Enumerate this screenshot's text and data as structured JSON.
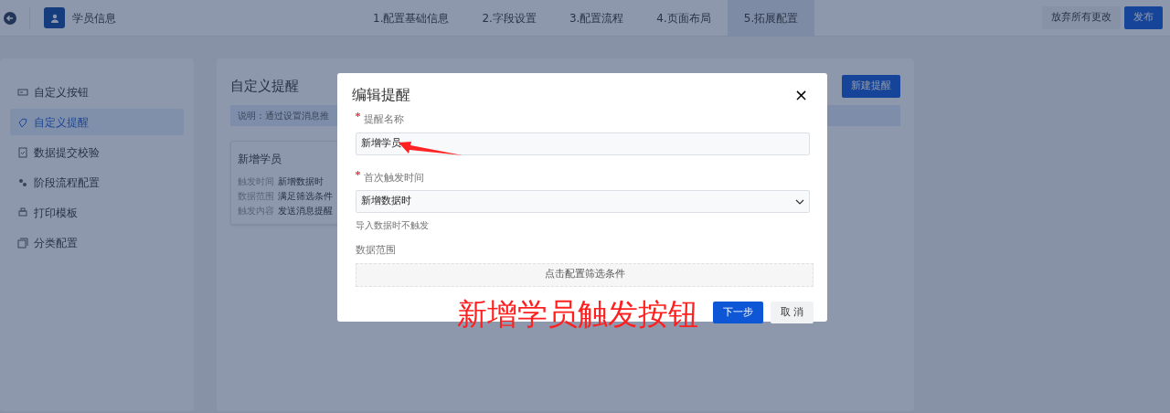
{
  "header": {
    "title": "学员信息",
    "steps": [
      {
        "label": "1.配置基础信息",
        "selected": false
      },
      {
        "label": "2.字段设置",
        "selected": false
      },
      {
        "label": "3.配置流程",
        "selected": false
      },
      {
        "label": "4.页面布局",
        "selected": false
      },
      {
        "label": "5.拓展配置",
        "selected": true
      }
    ],
    "buttons": [
      {
        "label": "放弃所有更改",
        "kind": "secondary"
      },
      {
        "label": "发布",
        "kind": "primary"
      }
    ]
  },
  "sidebar": {
    "items": [
      {
        "label": "自定义按钮",
        "selected": false
      },
      {
        "label": "自定义提醒",
        "selected": true
      },
      {
        "label": "数据提交校验",
        "selected": false
      },
      {
        "label": "阶段流程配置",
        "selected": false
      },
      {
        "label": "打印模板",
        "selected": false
      },
      {
        "label": "分类配置",
        "selected": false
      }
    ]
  },
  "main": {
    "title": "自定义提醒",
    "new_button": "新建提醒",
    "notice": "说明：通过设置消息推",
    "card": {
      "title": "新增学员",
      "rows": [
        {
          "label": "触发时间",
          "value": "新增数据时"
        },
        {
          "label": "数据范围",
          "value": "满足筛选条件"
        },
        {
          "label": "触发内容",
          "value": "发送消息提醒"
        }
      ]
    }
  },
  "modal": {
    "title": "编辑提醒",
    "close": "×",
    "fields": [
      {
        "label": "提醒名称",
        "required": true,
        "kind": "input",
        "value": "新增学员"
      },
      {
        "label": "首次触发时间",
        "required": true,
        "kind": "select",
        "value": "新增数据时",
        "hint": "导入数据时不触发"
      },
      {
        "label": "数据范围",
        "required": false,
        "kind": "picker",
        "value": "点击配置筛选条件"
      }
    ],
    "buttons": [
      {
        "label": "下一步",
        "kind": "primary"
      },
      {
        "label": "取 消",
        "kind": "secondary"
      }
    ]
  },
  "annotation": {
    "text": "新增学员触发按钮"
  }
}
